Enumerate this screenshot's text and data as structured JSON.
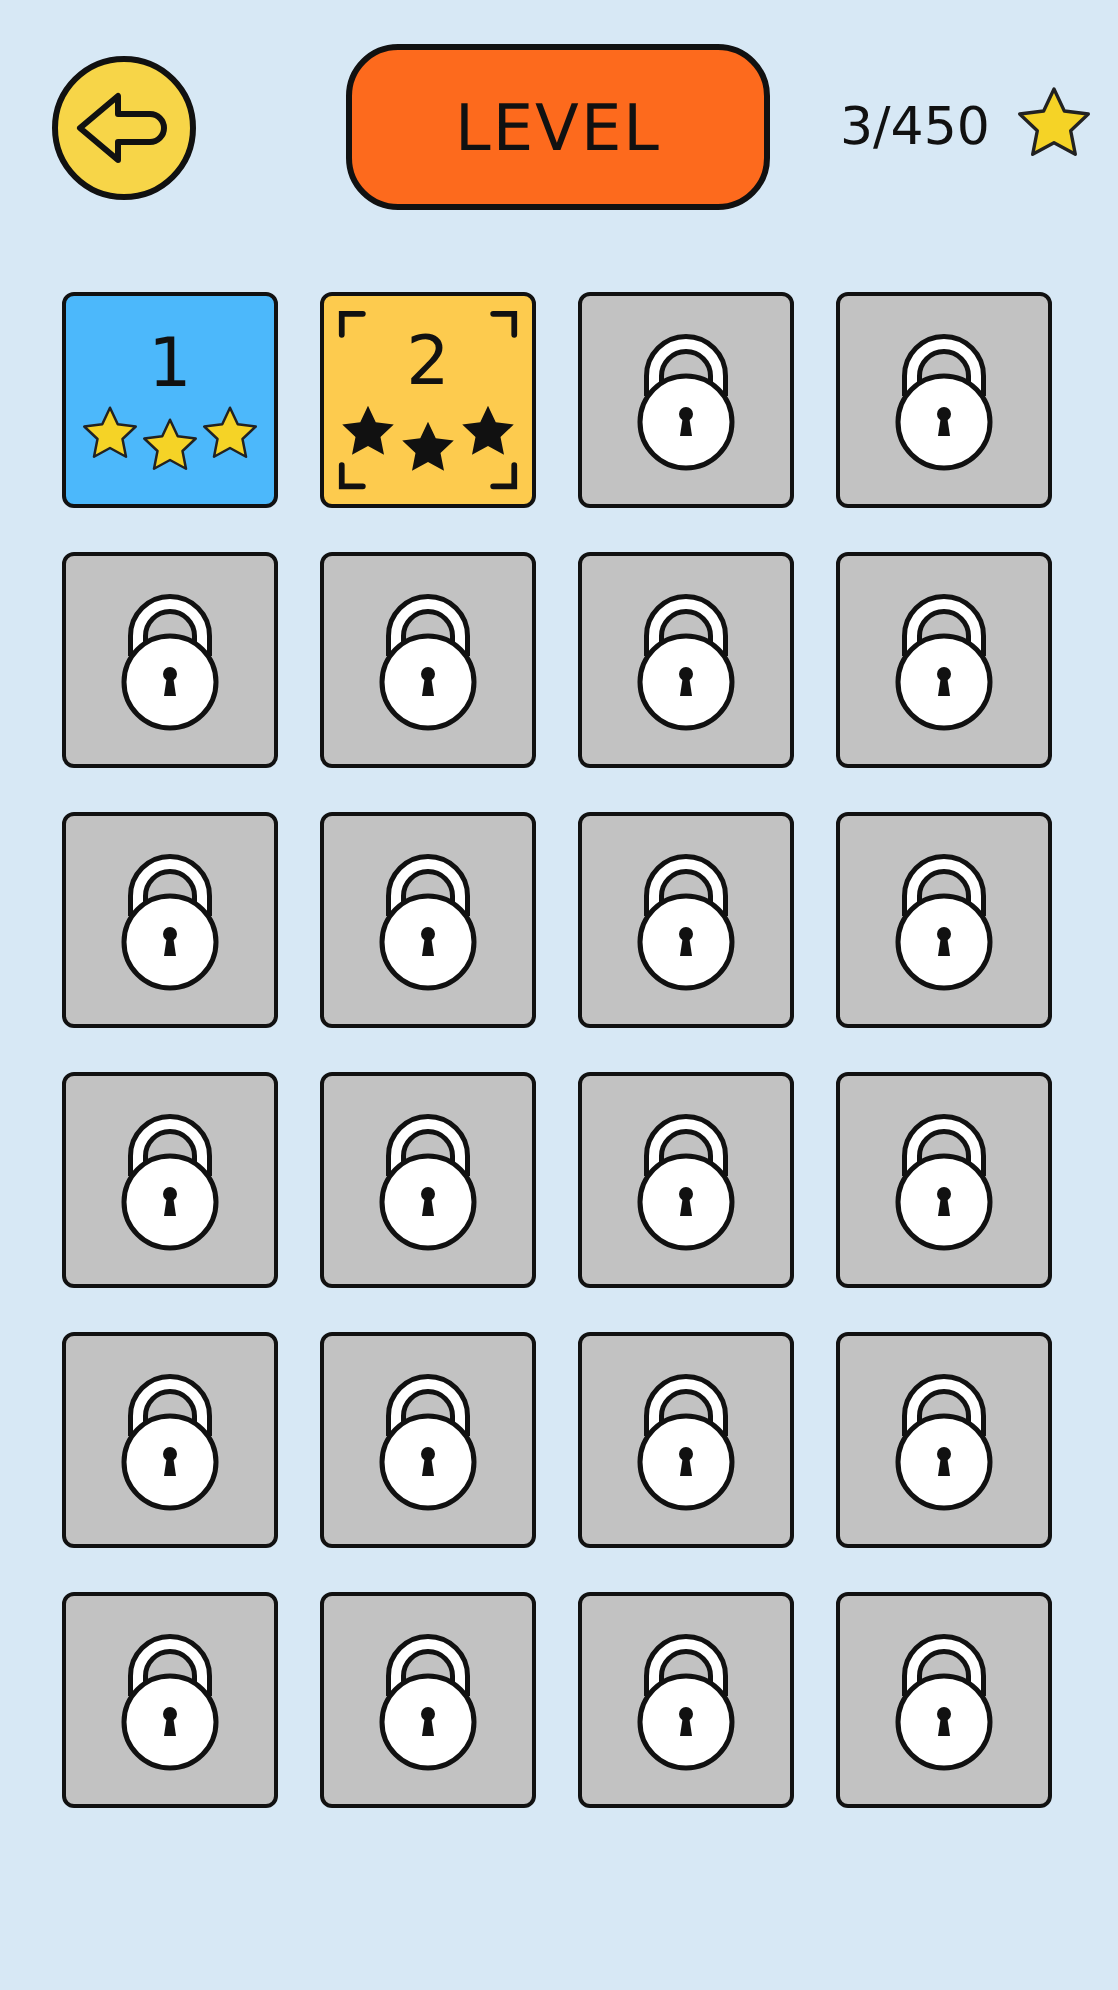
{
  "header": {
    "title": "LEVEL",
    "progress": "3/450"
  },
  "levels": [
    {
      "kind": "done",
      "number": "1",
      "stars": 3
    },
    {
      "kind": "current",
      "number": "2"
    },
    {
      "kind": "locked"
    },
    {
      "kind": "locked"
    },
    {
      "kind": "locked"
    },
    {
      "kind": "locked"
    },
    {
      "kind": "locked"
    },
    {
      "kind": "locked"
    },
    {
      "kind": "locked"
    },
    {
      "kind": "locked"
    },
    {
      "kind": "locked"
    },
    {
      "kind": "locked"
    },
    {
      "kind": "locked"
    },
    {
      "kind": "locked"
    },
    {
      "kind": "locked"
    },
    {
      "kind": "locked"
    },
    {
      "kind": "locked"
    },
    {
      "kind": "locked"
    },
    {
      "kind": "locked"
    },
    {
      "kind": "locked"
    },
    {
      "kind": "locked"
    },
    {
      "kind": "locked"
    },
    {
      "kind": "locked"
    },
    {
      "kind": "locked"
    }
  ]
}
